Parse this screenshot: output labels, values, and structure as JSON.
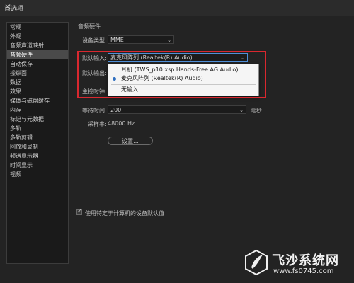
{
  "window": {
    "title": "首选项",
    "close_glyph": "✕"
  },
  "sidebar": {
    "items": [
      {
        "label": "常规"
      },
      {
        "label": "外观"
      },
      {
        "label": "音频声道映射"
      },
      {
        "label": "音频硬件",
        "active": true
      },
      {
        "label": "自动保存"
      },
      {
        "label": "操纵面"
      },
      {
        "label": "数据"
      },
      {
        "label": "效果"
      },
      {
        "label": "媒体与磁盘缓存"
      },
      {
        "label": "内存"
      },
      {
        "label": "标记与元数据"
      },
      {
        "label": "多轨"
      },
      {
        "label": "多轨剪辑"
      },
      {
        "label": "回放和录制"
      },
      {
        "label": "频谱显示器"
      },
      {
        "label": "时间显示"
      },
      {
        "label": "视频"
      }
    ]
  },
  "audio_hardware": {
    "section_title": "音频硬件",
    "device_type_label": "设备类型:",
    "device_type_value": "MME",
    "default_input_label": "默认输入:",
    "default_input_value": "麦克风阵列 (Realtek(R) Audio)",
    "default_output_label": "默认输出:",
    "master_clock_label": "主控时钟:",
    "latency_label": "等待时间:",
    "latency_value": "200",
    "latency_unit": "毫秒",
    "sample_rate_label": "采样率:",
    "sample_rate_value": "48000 Hz",
    "settings_button": "设置...",
    "default_checkbox_label": "使用特定于计算机的设备默认值",
    "default_checkbox_checked": true
  },
  "input_dropdown": {
    "options": [
      {
        "label": "耳机 (TWS_p10 xsp Hands-Free AG Audio)",
        "selected": false
      },
      {
        "label": "麦克风阵列 (Realtek(R) Audio)",
        "selected": true
      },
      {
        "label": "无输入",
        "selected": false
      }
    ]
  },
  "watermark": {
    "title": "飞沙系统网",
    "url": "www.fs0745.com"
  },
  "colors": {
    "highlight_box": "#d9282f",
    "accent": "#2f6fc0"
  }
}
